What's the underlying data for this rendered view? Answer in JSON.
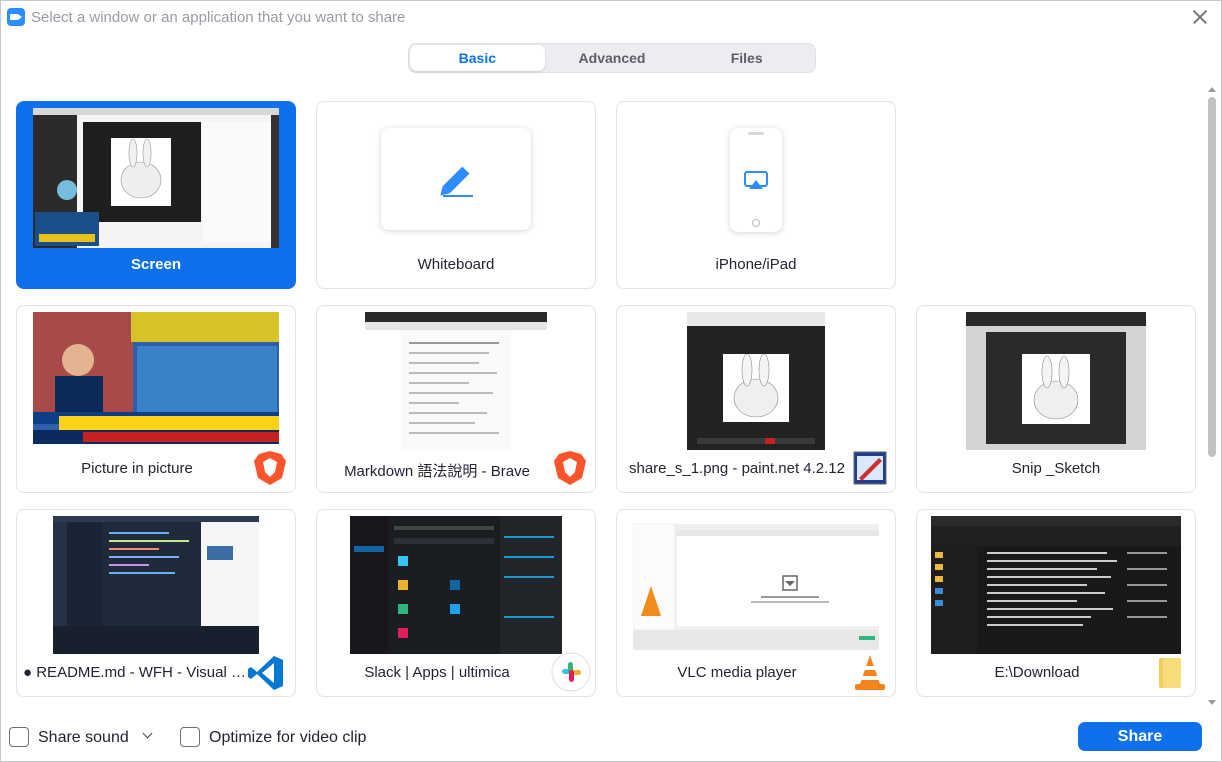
{
  "window": {
    "title": "Select a window or an application that you want to share",
    "close_icon": "close-icon",
    "app_icon": "zoom-camera-icon"
  },
  "tabs": [
    {
      "label": "Basic",
      "active": true
    },
    {
      "label": "Advanced",
      "active": false
    },
    {
      "label": "Files",
      "active": false
    }
  ],
  "cards": [
    {
      "label": "Screen",
      "selected": true,
      "kind": "screen"
    },
    {
      "label": "Whiteboard",
      "selected": false,
      "kind": "whiteboard",
      "icon": "pencil-icon"
    },
    {
      "label": "iPhone/iPad",
      "selected": false,
      "kind": "device",
      "icon": "airplay-icon"
    },
    {
      "label": "Picture in picture",
      "selected": false,
      "kind": "window",
      "app_icon": "brave-lion-icon"
    },
    {
      "label": "Markdown 語法說明 - Brave",
      "selected": false,
      "kind": "window",
      "app_icon": "brave-lion-icon"
    },
    {
      "label": "share_s_1.png - paint.net 4.2.12",
      "selected": false,
      "kind": "window",
      "app_icon": "paint-net-icon"
    },
    {
      "label": "Snip _Sketch",
      "selected": false,
      "kind": "window",
      "app_icon": ""
    },
    {
      "label": "● README.md - WFH - Visual Stu...",
      "selected": false,
      "kind": "window",
      "app_icon": "vscode-icon"
    },
    {
      "label": "Slack | Apps | ultimica",
      "selected": false,
      "kind": "window",
      "app_icon": "slack-icon"
    },
    {
      "label": "VLC media player",
      "selected": false,
      "kind": "window",
      "app_icon": "vlc-cone-icon"
    },
    {
      "label": "E:\\Download",
      "selected": false,
      "kind": "window",
      "app_icon": "folder-icon"
    }
  ],
  "footer": {
    "share_sound_label": "Share sound",
    "optimize_label": "Optimize for video clip",
    "share_button_label": "Share"
  },
  "colors": {
    "accent": "#0e71eb",
    "tab_bg": "#ededf1",
    "card_border": "#e3e3e8"
  }
}
